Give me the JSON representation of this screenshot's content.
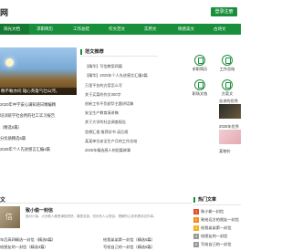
{
  "header": {
    "logo": "网",
    "login_label": "登录注册"
  },
  "nav": {
    "items": [
      {
        "label": "阳光文档"
      },
      {
        "label": "求职简历"
      },
      {
        "label": "工作总结"
      },
      {
        "label": "作文范文"
      },
      {
        "label": "实用文"
      },
      {
        "label": "情感美文"
      },
      {
        "label": "古诗文"
      }
    ]
  },
  "banner": {
    "caption": "晚不敢亦问 雄心英雄气壮山河，"
  },
  "left_list": {
    "items": [
      {
        "text": "2020年中学安心满知道日精编精"
      },
      {
        "text": "培训班学社会用的社工实习报告"
      },
      {
        "text": "（精选5篇）"
      },
      {
        "text": "分优质精选5篇"
      },
      {
        "text": "2025年个人先进感言汇编4篇"
      }
    ]
  },
  "featured": {
    "title": "范文推荐",
    "items": [
      {
        "n": "",
        "text": "【精华】写信教案四篇"
      },
      {
        "n": "",
        "text": "【精华】2025年个人先进感言汇编4篇"
      },
      {
        "n": "",
        "text": "万里平台的方案怎么写"
      },
      {
        "n": "",
        "text": "关于买菜的作文300字"
      },
      {
        "n": "",
        "text": "创新工作不负韶华主题讲话稿"
      },
      {
        "n": "",
        "text": "安全生产教育演讲稿"
      },
      {
        "n": "",
        "text": "关于大学的社会调查报告"
      },
      {
        "n": "",
        "text": "思想汇报 推荐好书 读后感"
      },
      {
        "n": "",
        "text": "某某单位安全生产月的工作总结"
      },
      {
        "n": "",
        "text": "2025年精选感人的短篇故事"
      }
    ]
  },
  "icon_grid": {
    "items": [
      {
        "label": "求职简历",
        "icon": "resume-icon"
      },
      {
        "label": "工作总结",
        "icon": "summary-icon"
      },
      {
        "label": "职场文档",
        "icon": "doc-icon"
      },
      {
        "label": "方案文",
        "icon": "plan-icon"
      }
    ]
  },
  "side": {
    "item1": "苦求的优秀",
    "item2": "2025年优秀",
    "item3": "某物价"
  },
  "section2": {
    "title": "文",
    "article": {
      "img_text": "信",
      "title": "致小偷一封信",
      "desc": "面对小偷，大多数人都是满腔愤怒，痛恨至极，但也有人以宽容、理解的心态来看待这件事。"
    },
    "list": [
      {
        "text": "年后高四精选一封信（精选5篇）"
      },
      {
        "text": "给我弟弟第一封信（精选5篇）"
      },
      {
        "text": "给朋友的一封信（精选4篇）"
      },
      {
        "text": "写给自己的一封信（精选5篇）"
      }
    ]
  },
  "hot": {
    "title": "热门文章",
    "items": [
      {
        "n": "1",
        "text": "致小偷一封信"
      },
      {
        "n": "2",
        "text": "致给远方的朋友一封信"
      },
      {
        "n": "3",
        "text": "给我弟弟第一封信"
      },
      {
        "n": "4",
        "text": "给朋友的一封信"
      },
      {
        "n": "5",
        "text": "写给自己的一封信"
      }
    ]
  }
}
